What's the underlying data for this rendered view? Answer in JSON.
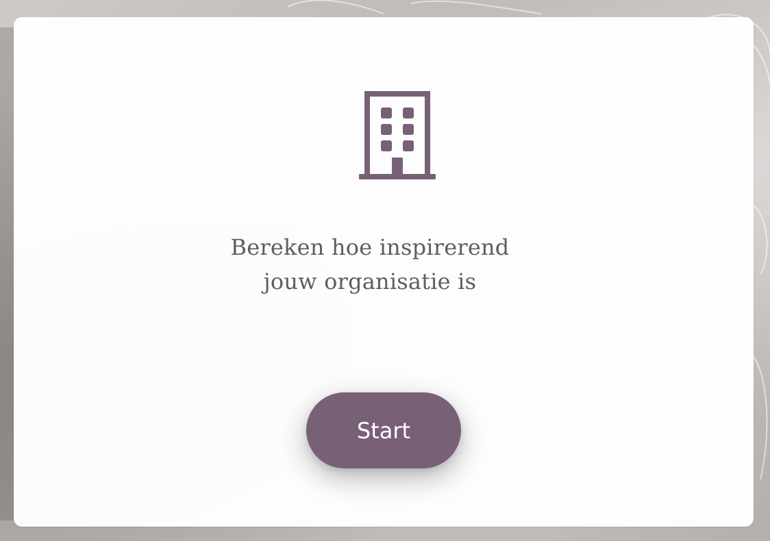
{
  "card": {
    "headline_line1": "Bereken hoe inspirerend",
    "headline_line2": "jouw organisatie is",
    "start_label": "Start"
  },
  "icons": {
    "main": "building-icon"
  },
  "colors": {
    "accent": "#786077",
    "text": "#5f5c5c",
    "card_bg": "#fbfbfb"
  }
}
